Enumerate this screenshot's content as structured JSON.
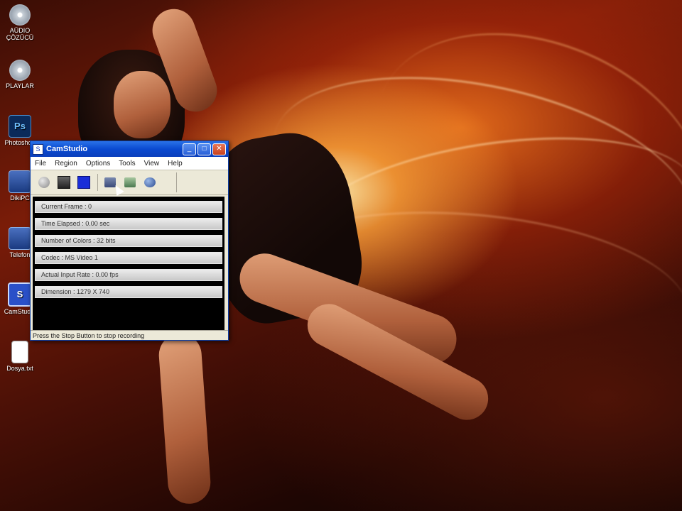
{
  "desktop_icons": [
    {
      "label": "AÜDIO\nÇÖZÜCÜ",
      "icon": "disc-icon"
    },
    {
      "label": "PLAYLAR",
      "icon": "disc-icon"
    },
    {
      "label": "Photoshop",
      "icon": "photoshop-icon"
    },
    {
      "label": "DikiPC",
      "icon": "computer-icon"
    },
    {
      "label": "Telefon",
      "icon": "program-icon"
    },
    {
      "label": "CamStudio",
      "icon": "camstudio-icon"
    },
    {
      "label": "Dosya.txt",
      "icon": "text-file-icon"
    }
  ],
  "window": {
    "title": "CamStudio",
    "menu": [
      "File",
      "Region",
      "Options",
      "Tools",
      "View",
      "Help"
    ],
    "toolbar": {
      "record": "record-icon",
      "pause": "pause-icon",
      "stop": "stop-icon",
      "annotate": "annotate-icon",
      "region": "region-icon",
      "web": "web-icon"
    },
    "stats": [
      "Current Frame : 0",
      "Time Elapsed : 0.00 sec",
      "Number of Colors : 32 bits",
      "Codec : MS Video 1",
      "Actual Input Rate : 0.00 fps",
      "Dimension : 1279 X 740"
    ],
    "status": "Press the Stop Button to stop recording"
  }
}
